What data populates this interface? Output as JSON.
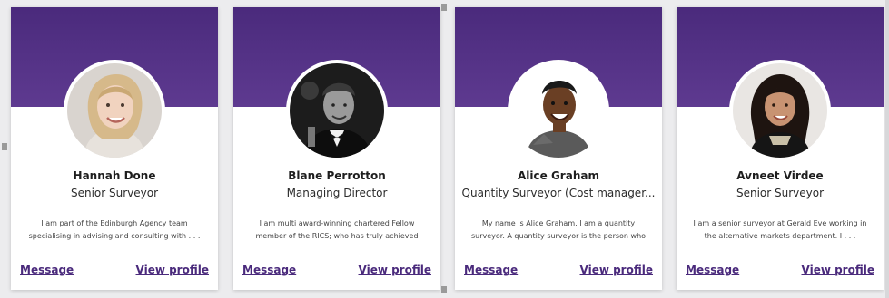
{
  "colors": {
    "header_purple": "#4a2a7c",
    "link_purple": "#4a2a7c",
    "card_bg": "#ffffff"
  },
  "cards": [
    {
      "name": "Hannah Done",
      "role": "Senior Surveyor",
      "bio_line1": "I am part of the Edinburgh Agency team",
      "bio_line2": "specialising in advising and consulting with . . .",
      "message_label": "Message",
      "profile_label": "View profile",
      "avatar_icon": "person-photo"
    },
    {
      "name": "Blane Perrotton",
      "role": "Managing Director",
      "bio_line1": "I am multi award-winning chartered Fellow",
      "bio_line2": "member of the RICS; who has truly achieved",
      "message_label": "Message",
      "profile_label": "View profile",
      "avatar_icon": "person-photo"
    },
    {
      "name": "Alice Graham",
      "role": "Quantity Surveyor (Cost manager...",
      "bio_line1": "My name is Alice Graham. I am a quantity",
      "bio_line2": "surveyor. A quantity surveyor is the person who",
      "message_label": "Message",
      "profile_label": "View profile",
      "avatar_icon": "person-photo"
    },
    {
      "name": "Avneet Virdee",
      "role": "Senior Surveyor",
      "bio_line1": "I am a senior surveyor at Gerald Eve working in",
      "bio_line2": "the alternative markets department. I . . .",
      "message_label": "Message",
      "profile_label": "View profile",
      "avatar_icon": "person-photo"
    }
  ]
}
